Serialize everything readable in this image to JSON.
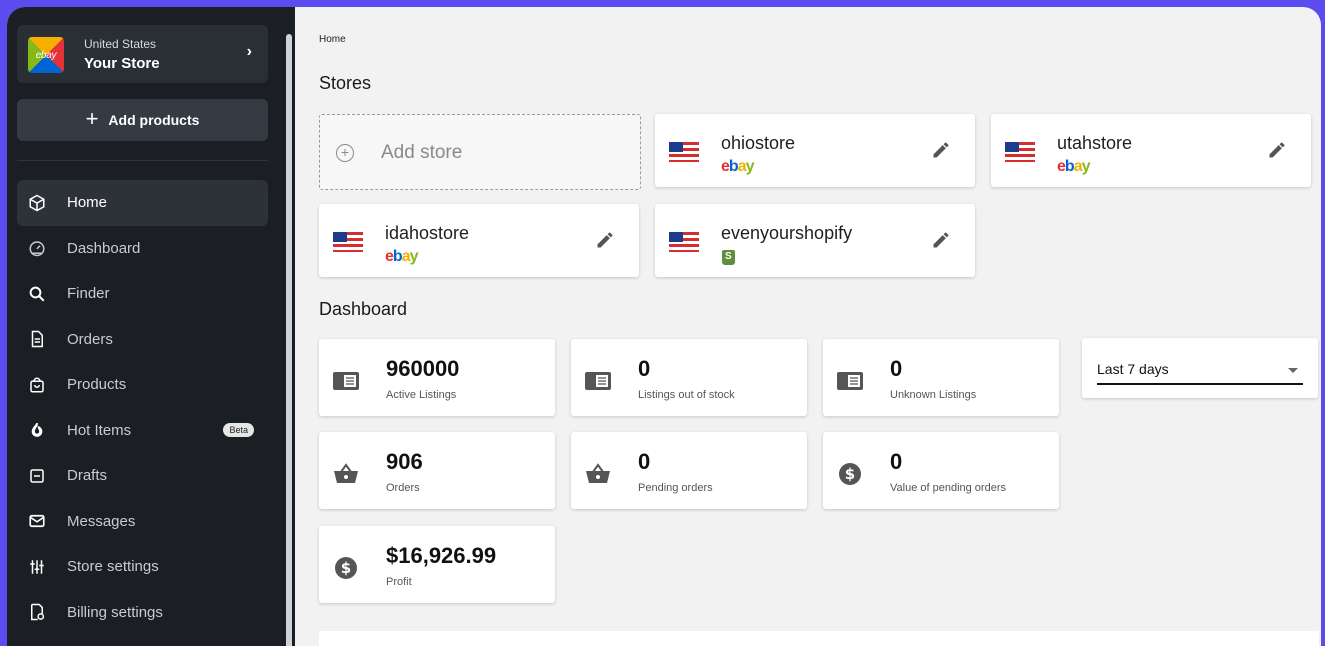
{
  "store": {
    "country": "United States",
    "name": "Your Store",
    "logo_text": "ebay"
  },
  "sidebar": {
    "add_products_label": "Add products",
    "items": [
      {
        "label": "Home",
        "icon": "cube-icon",
        "active": true
      },
      {
        "label": "Dashboard",
        "icon": "gauge-icon"
      },
      {
        "label": "Finder",
        "icon": "search-icon"
      },
      {
        "label": "Orders",
        "icon": "document-icon"
      },
      {
        "label": "Products",
        "icon": "bag-icon"
      },
      {
        "label": "Hot Items",
        "icon": "flame-icon",
        "badge": "Beta"
      },
      {
        "label": "Drafts",
        "icon": "drafts-icon"
      },
      {
        "label": "Messages",
        "icon": "envelope-icon"
      },
      {
        "label": "Store settings",
        "icon": "sliders-icon"
      },
      {
        "label": "Billing settings",
        "icon": "billing-icon"
      }
    ]
  },
  "main": {
    "breadcrumb": "Home",
    "stores_title": "Stores",
    "add_store_label": "Add store",
    "stores": [
      {
        "name": "ohiostore",
        "platform": "ebay"
      },
      {
        "name": "utahstore",
        "platform": "ebay"
      },
      {
        "name": "idahostore",
        "platform": "ebay"
      },
      {
        "name": "evenyourshopify",
        "platform": "shopify"
      }
    ],
    "dashboard_title": "Dashboard",
    "stats": [
      {
        "value": "960000",
        "label": "Active Listings",
        "icon": "listing-icon"
      },
      {
        "value": "0",
        "label": "Listings out of stock",
        "icon": "listing-icon"
      },
      {
        "value": "0",
        "label": "Unknown Listings",
        "icon": "listing-icon"
      },
      {
        "value": "906",
        "label": "Orders",
        "icon": "basket-icon"
      },
      {
        "value": "0",
        "label": "Pending orders",
        "icon": "basket-icon"
      },
      {
        "value": "0",
        "label": "Value of pending orders",
        "icon": "dollar-icon"
      },
      {
        "value": "$16,926.99",
        "label": "Profit",
        "icon": "dollar-icon"
      }
    ],
    "period_select": {
      "value": "Last 7 days"
    }
  },
  "colors": {
    "sidebar_bg": "#1b1f24",
    "accent_frame": "#5b4cf0",
    "main_bg": "#f2f2f2"
  }
}
